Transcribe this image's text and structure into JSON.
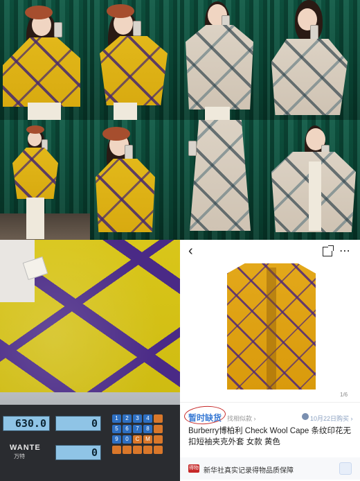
{
  "product_page": {
    "counter": "1/6",
    "status_label": "暂时缺货",
    "similar_link": "找相似款 ›",
    "purchase_info": "10月22日购买 ›",
    "title": "Burberry博柏利 Check Wool Cape 条纹印花无扣短袖夹克外套 女款 黄色",
    "guarantee_label": "新华社真实记录得物品质保障",
    "guarantee_badge": "得物"
  },
  "scale": {
    "weight_reading": "630.0",
    "unit_price_reading": "0",
    "total_reading": "0",
    "brand": "WANTE",
    "brand_cn": "万特",
    "keys": [
      "1",
      "2",
      "3",
      "4",
      "5",
      "6",
      "7",
      "8",
      "9",
      "0",
      "C",
      "M"
    ]
  },
  "colors": {
    "accent_blue": "#3a7bd5",
    "annotation_red": "#c62828",
    "cape_yellow": "#e2b81a",
    "check_purple": "#4a2a86",
    "curtain_green": "#0f5a45"
  }
}
